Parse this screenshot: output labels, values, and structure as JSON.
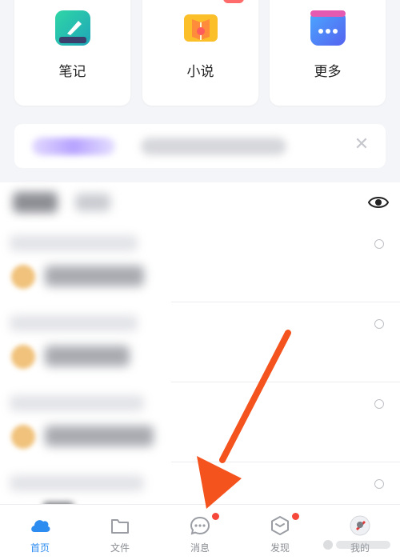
{
  "apps": [
    {
      "label": "笔记",
      "icon": "note-pen-icon"
    },
    {
      "label": "小说",
      "icon": "book-icon"
    },
    {
      "label": "更多",
      "icon": "more-dots-icon"
    }
  ],
  "banner": {
    "close_icon": "close-icon"
  },
  "recent": {
    "eye_icon": "eye-icon"
  },
  "list": {
    "rows": 4
  },
  "tabs": [
    {
      "label": "首页",
      "icon": "cloud-home-icon",
      "active": true
    },
    {
      "label": "文件",
      "icon": "folder-icon",
      "active": false
    },
    {
      "label": "消息",
      "icon": "chat-bubble-icon",
      "active": false,
      "badge": true
    },
    {
      "label": "发现",
      "icon": "discover-cube-icon",
      "active": false,
      "badge": true
    },
    {
      "label": "我的",
      "icon": "avatar-icon",
      "active": false
    }
  ],
  "colors": {
    "accent": "#2d8cf0",
    "badge": "#f5483b",
    "arrow": "#f4531e"
  }
}
